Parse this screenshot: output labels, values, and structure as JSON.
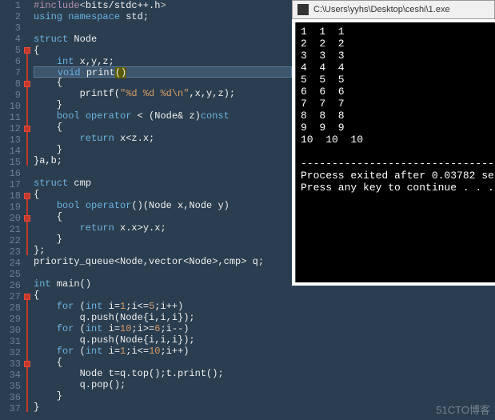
{
  "editor": {
    "highlight_line": 7,
    "lines": [
      {
        "n": 1,
        "seg": [
          {
            "c": "pp",
            "t": "#include"
          },
          {
            "c": "op",
            "t": "<"
          },
          {
            "c": "",
            "t": "bits/stdc++.h"
          },
          {
            "c": "op",
            "t": ">"
          }
        ]
      },
      {
        "n": 2,
        "seg": [
          {
            "c": "kw",
            "t": "using"
          },
          {
            "c": "",
            "t": " "
          },
          {
            "c": "kw",
            "t": "namespace"
          },
          {
            "c": "",
            "t": " std;"
          }
        ]
      },
      {
        "n": 3,
        "seg": []
      },
      {
        "n": 4,
        "seg": [
          {
            "c": "kw",
            "t": "struct"
          },
          {
            "c": "",
            "t": " Node"
          }
        ]
      },
      {
        "n": 5,
        "seg": [
          {
            "c": "",
            "t": "{"
          }
        ]
      },
      {
        "n": 6,
        "seg": [
          {
            "c": "",
            "t": "    "
          },
          {
            "c": "kw",
            "t": "int"
          },
          {
            "c": "",
            "t": " x,y,z;"
          }
        ]
      },
      {
        "n": 7,
        "seg": [
          {
            "c": "",
            "t": "    "
          },
          {
            "c": "kw",
            "t": "void"
          },
          {
            "c": "",
            "t": " print"
          },
          {
            "c": "brace-hl",
            "t": "("
          },
          {
            "c": "brace-hl",
            "t": ")"
          }
        ]
      },
      {
        "n": 8,
        "seg": [
          {
            "c": "",
            "t": "    {"
          }
        ]
      },
      {
        "n": 9,
        "seg": [
          {
            "c": "",
            "t": "        printf("
          },
          {
            "c": "str",
            "t": "\"%d %d %d\\n\""
          },
          {
            "c": "",
            "t": ",x,y,z);"
          }
        ]
      },
      {
        "n": 10,
        "seg": [
          {
            "c": "",
            "t": "    }"
          }
        ]
      },
      {
        "n": 11,
        "seg": [
          {
            "c": "",
            "t": "    "
          },
          {
            "c": "kw",
            "t": "bool"
          },
          {
            "c": "",
            "t": " "
          },
          {
            "c": "kw",
            "t": "operator"
          },
          {
            "c": "",
            "t": " < (Node& z)"
          },
          {
            "c": "kw",
            "t": "const"
          }
        ]
      },
      {
        "n": 12,
        "seg": [
          {
            "c": "",
            "t": "    {"
          }
        ]
      },
      {
        "n": 13,
        "seg": [
          {
            "c": "",
            "t": "        "
          },
          {
            "c": "kw",
            "t": "return"
          },
          {
            "c": "",
            "t": " x<z.x;"
          }
        ]
      },
      {
        "n": 14,
        "seg": [
          {
            "c": "",
            "t": "    }"
          }
        ]
      },
      {
        "n": 15,
        "seg": [
          {
            "c": "",
            "t": "}a,b;"
          }
        ]
      },
      {
        "n": 16,
        "seg": []
      },
      {
        "n": 17,
        "seg": [
          {
            "c": "kw",
            "t": "struct"
          },
          {
            "c": "",
            "t": " cmp"
          }
        ]
      },
      {
        "n": 18,
        "seg": [
          {
            "c": "",
            "t": "{"
          }
        ]
      },
      {
        "n": 19,
        "seg": [
          {
            "c": "",
            "t": "    "
          },
          {
            "c": "kw",
            "t": "bool"
          },
          {
            "c": "",
            "t": " "
          },
          {
            "c": "kw",
            "t": "operator"
          },
          {
            "c": "",
            "t": "()(Node x,Node y)"
          }
        ]
      },
      {
        "n": 20,
        "seg": [
          {
            "c": "",
            "t": "    {"
          }
        ]
      },
      {
        "n": 21,
        "seg": [
          {
            "c": "",
            "t": "        "
          },
          {
            "c": "kw",
            "t": "return"
          },
          {
            "c": "",
            "t": " x.x>y.x;"
          }
        ]
      },
      {
        "n": 22,
        "seg": [
          {
            "c": "",
            "t": "    }"
          }
        ]
      },
      {
        "n": 23,
        "seg": [
          {
            "c": "",
            "t": "};"
          }
        ]
      },
      {
        "n": 24,
        "seg": [
          {
            "c": "",
            "t": "priority_queue<Node,vector<Node>,cmp> q;"
          }
        ]
      },
      {
        "n": 25,
        "seg": []
      },
      {
        "n": 26,
        "seg": [
          {
            "c": "kw",
            "t": "int"
          },
          {
            "c": "",
            "t": " main()"
          }
        ]
      },
      {
        "n": 27,
        "seg": [
          {
            "c": "",
            "t": "{"
          }
        ]
      },
      {
        "n": 28,
        "seg": [
          {
            "c": "",
            "t": "    "
          },
          {
            "c": "kw",
            "t": "for"
          },
          {
            "c": "",
            "t": " ("
          },
          {
            "c": "kw",
            "t": "int"
          },
          {
            "c": "",
            "t": " i="
          },
          {
            "c": "num",
            "t": "1"
          },
          {
            "c": "",
            "t": ";i<="
          },
          {
            "c": "num",
            "t": "5"
          },
          {
            "c": "",
            "t": ";i++)"
          }
        ]
      },
      {
        "n": 29,
        "seg": [
          {
            "c": "",
            "t": "        q.push(Node{i,i,i});"
          }
        ]
      },
      {
        "n": 30,
        "seg": [
          {
            "c": "",
            "t": "    "
          },
          {
            "c": "kw",
            "t": "for"
          },
          {
            "c": "",
            "t": " ("
          },
          {
            "c": "kw",
            "t": "int"
          },
          {
            "c": "",
            "t": " i="
          },
          {
            "c": "num",
            "t": "10"
          },
          {
            "c": "",
            "t": ";i>="
          },
          {
            "c": "num",
            "t": "6"
          },
          {
            "c": "",
            "t": ";i--)"
          }
        ]
      },
      {
        "n": 31,
        "seg": [
          {
            "c": "",
            "t": "        q.push(Node{i,i,i});"
          }
        ]
      },
      {
        "n": 32,
        "seg": [
          {
            "c": "",
            "t": "    "
          },
          {
            "c": "kw",
            "t": "for"
          },
          {
            "c": "",
            "t": " ("
          },
          {
            "c": "kw",
            "t": "int"
          },
          {
            "c": "",
            "t": " i="
          },
          {
            "c": "num",
            "t": "1"
          },
          {
            "c": "",
            "t": ";i<="
          },
          {
            "c": "num",
            "t": "10"
          },
          {
            "c": "",
            "t": ";i++)"
          }
        ]
      },
      {
        "n": 33,
        "seg": [
          {
            "c": "",
            "t": "    {"
          }
        ]
      },
      {
        "n": 34,
        "seg": [
          {
            "c": "",
            "t": "        Node t=q.top();t.print();"
          }
        ]
      },
      {
        "n": 35,
        "seg": [
          {
            "c": "",
            "t": "        q.pop();"
          }
        ]
      },
      {
        "n": 36,
        "seg": [
          {
            "c": "",
            "t": "    }"
          }
        ]
      },
      {
        "n": 37,
        "seg": [
          {
            "c": "",
            "t": "}"
          }
        ]
      }
    ],
    "fold_marks": [
      5,
      8,
      12,
      18,
      20,
      27,
      33
    ],
    "fold_ranges": [
      [
        5,
        15
      ],
      [
        8,
        10
      ],
      [
        12,
        14
      ],
      [
        18,
        23
      ],
      [
        20,
        22
      ],
      [
        27,
        37
      ],
      [
        33,
        36
      ]
    ]
  },
  "console": {
    "title": "C:\\Users\\yyhs\\Desktop\\ceshi\\1.exe",
    "output": [
      "1  1  1",
      "2  2  2",
      "3  3  3",
      "4  4  4",
      "5  5  5",
      "6  6  6",
      "7  7  7",
      "8  8  8",
      "9  9  9",
      "10  10  10",
      "",
      "--------------------------------",
      "Process exited after 0.03782 se",
      "Press any key to continue . . ."
    ]
  },
  "watermark": "51CTO博客"
}
